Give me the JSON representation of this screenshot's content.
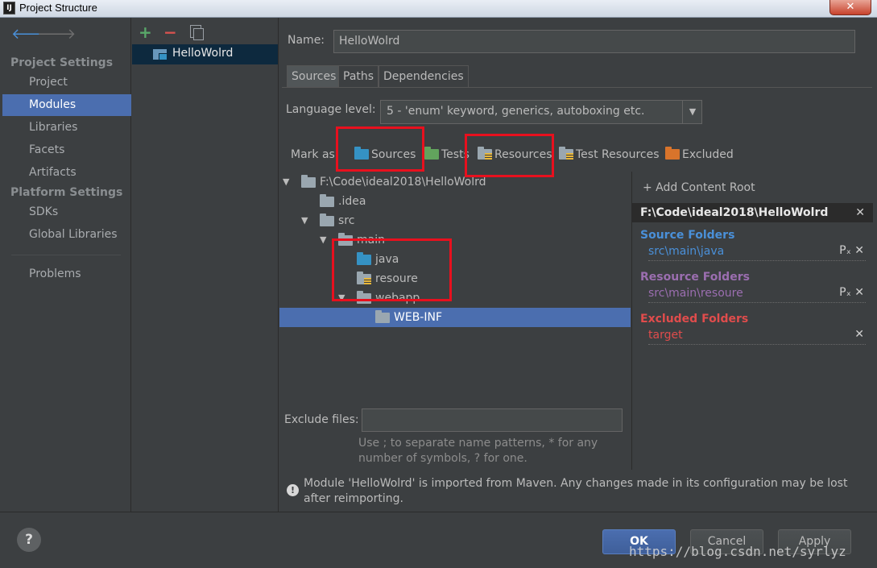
{
  "window": {
    "title": "Project Structure",
    "app_icon": "IJ",
    "close_label": "✕"
  },
  "nav": {
    "back_icon": "🡐",
    "forward_icon": "🡒",
    "project_settings_header": "Project Settings",
    "project_items": [
      "Project",
      "Modules",
      "Libraries",
      "Facets",
      "Artifacts"
    ],
    "platform_settings_header": "Platform Settings",
    "platform_items": [
      "SDKs",
      "Global Libraries"
    ],
    "problems": "Problems",
    "selected": "Modules"
  },
  "modules": {
    "add": "+",
    "remove": "−",
    "items": [
      "HelloWolrd"
    ]
  },
  "name": {
    "label": "Name:",
    "value": "HelloWolrd"
  },
  "tabs": [
    "Sources",
    "Paths",
    "Dependencies"
  ],
  "language_level": {
    "label": "Language level:",
    "value": "5 - 'enum' keyword, generics, autoboxing etc.",
    "arrow": "▼"
  },
  "mark_as": {
    "label": "Mark as:",
    "items": [
      "Sources",
      "Tests",
      "Resources",
      "Test Resources",
      "Excluded"
    ]
  },
  "tree": {
    "expander_open": "▼",
    "root": "F:\\Code\\ideal2018\\HelloWolrd",
    "idea": ".idea",
    "src": "src",
    "main": "main",
    "java": "java",
    "resoure": "resoure",
    "webapp": "webapp",
    "webinf": "WEB-INF"
  },
  "content_root": {
    "add_label": "+ Add Content Root",
    "path": "F:\\Code\\ideal2018\\HelloWolrd",
    "close": "✕",
    "source_header": "Source Folders",
    "source_path": "src\\main\\java",
    "resource_header": "Resource Folders",
    "resource_path": "src\\main\\resoure",
    "excluded_header": "Excluded Folders",
    "excluded_path": "target",
    "props_icon": "Pₓ",
    "colors": {
      "source": "#4a90d9",
      "resource": "#9b6eb0",
      "excluded": "#e04c4c"
    }
  },
  "exclude_files": {
    "label": "Exclude files:",
    "value": "",
    "hint": "Use ; to separate name patterns, * for any number of symbols, ? for one."
  },
  "warning": {
    "icon": "!",
    "text": "Module 'HelloWolrd' is imported from Maven. Any changes made in its configuration may be lost after reimporting."
  },
  "buttons": {
    "help": "?",
    "ok": "OK",
    "cancel": "Cancel",
    "apply": "Apply"
  },
  "watermark": "https://blog.csdn.net/syrlyz"
}
